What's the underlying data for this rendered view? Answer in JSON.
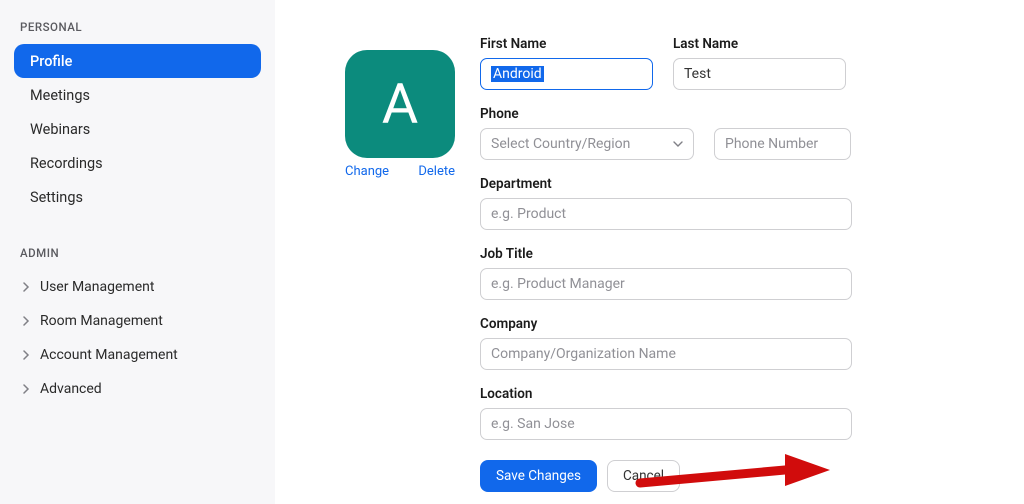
{
  "sidebar": {
    "personal_label": "PERSONAL",
    "items": [
      "Profile",
      "Meetings",
      "Webinars",
      "Recordings",
      "Settings"
    ],
    "admin_label": "ADMIN",
    "admin_items": [
      "User Management",
      "Room Management",
      "Account Management",
      "Advanced"
    ]
  },
  "avatar": {
    "initial": "A",
    "change": "Change",
    "delete": "Delete"
  },
  "form": {
    "first_name_label": "First Name",
    "first_name_value": "Android",
    "last_name_label": "Last Name",
    "last_name_value": "Test",
    "phone_label": "Phone",
    "phone_country_placeholder": "Select Country/Region",
    "phone_number_placeholder": "Phone Number",
    "department_label": "Department",
    "department_placeholder": "e.g. Product",
    "job_title_label": "Job Title",
    "job_title_placeholder": "e.g. Product Manager",
    "company_label": "Company",
    "company_placeholder": "Company/Organization Name",
    "location_label": "Location",
    "location_placeholder": "e.g. San Jose",
    "save": "Save Changes",
    "cancel": "Cancel"
  }
}
